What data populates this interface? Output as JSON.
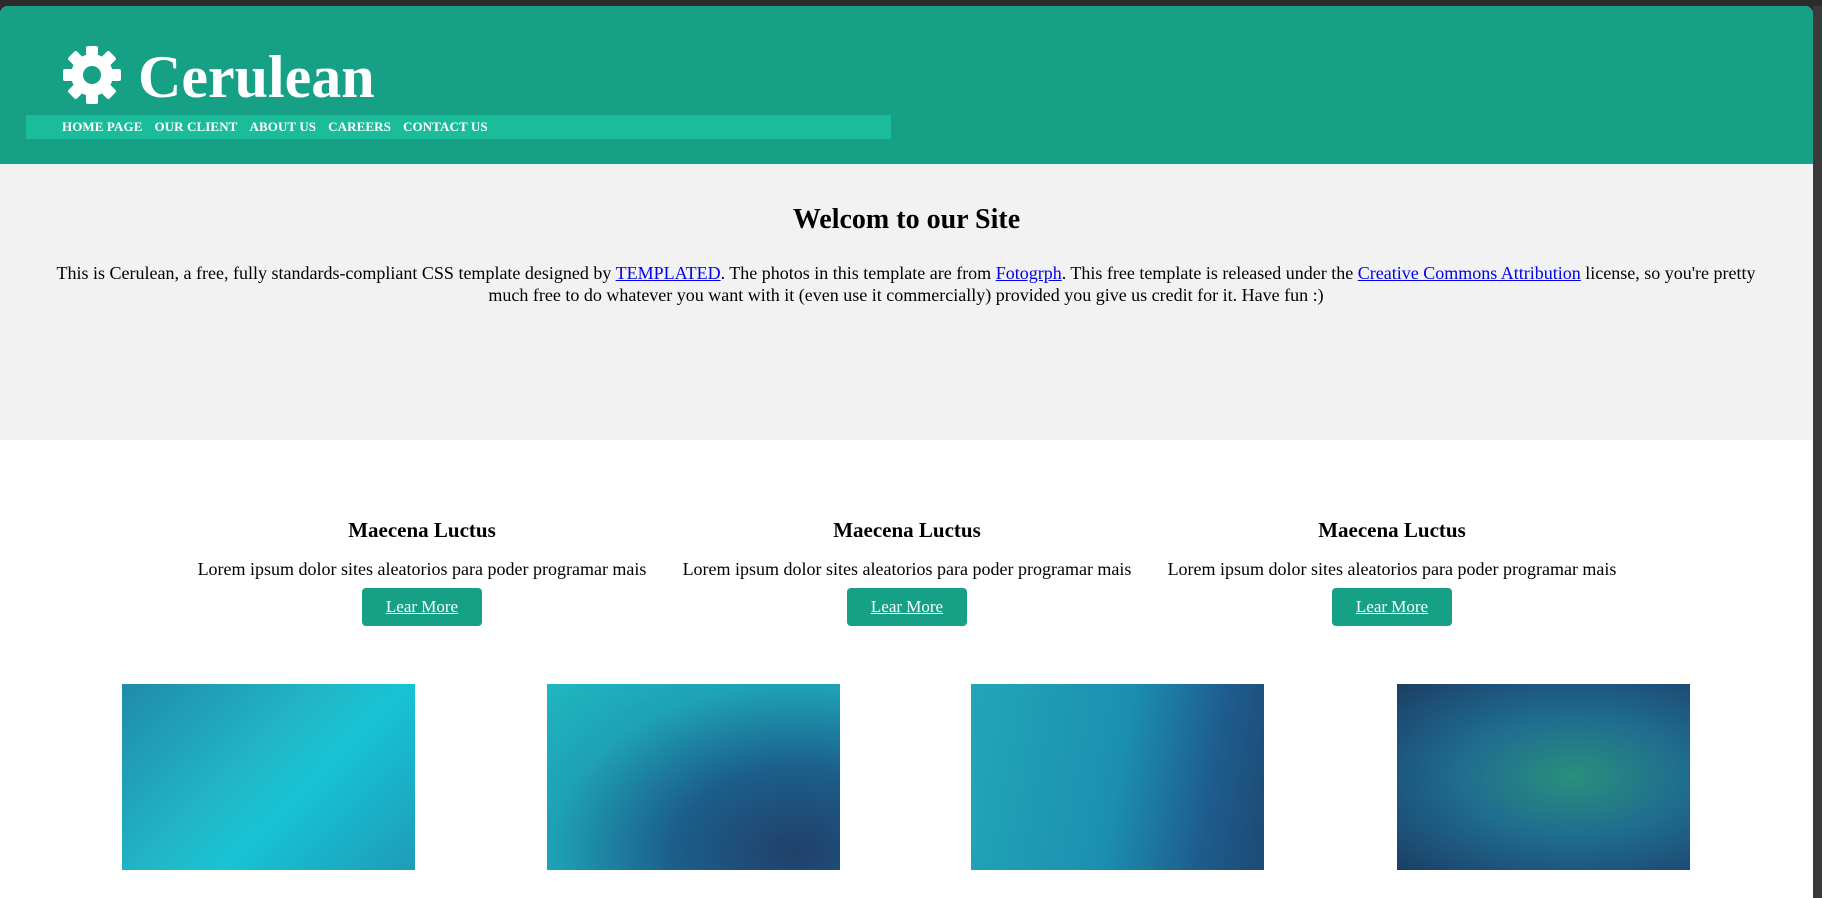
{
  "header": {
    "logo_text": "Cerulean",
    "nav": [
      "HOME PAGE",
      "OUR CLIENT",
      "ABOUT US",
      "CAREERS",
      "CONTACT US"
    ]
  },
  "intro": {
    "title": "Welcom to our Site",
    "text_1": "This is Cerulean, a free, fully standards-compliant CSS template designed by ",
    "link_1": "TEMPLATED",
    "text_2": ". The photos in this template are from ",
    "link_2": "Fotogrph",
    "text_3": ". This free template is released under the ",
    "link_3": "Creative Commons Attribution",
    "text_4": " license, so you're pretty much free to do whatever you want with it (even use it commercially) provided you give us credit for it. Have fun :)"
  },
  "features": [
    {
      "title": "Maecena Luctus",
      "text": "Lorem ipsum dolor sites aleatorios para poder programar mais",
      "button": "Lear More"
    },
    {
      "title": "Maecena Luctus",
      "text": "Lorem ipsum dolor sites aleatorios para poder programar mais",
      "button": "Lear More"
    },
    {
      "title": "Maecena Luctus",
      "text": "Lorem ipsum dolor sites aleatorios para poder programar mais",
      "button": "Lear More"
    }
  ],
  "colors": {
    "brand": "#16a085",
    "nav_bar": "#1abc9c",
    "intro_bg": "#f2f2f2"
  },
  "icons": {
    "logo": "gear-icon"
  }
}
